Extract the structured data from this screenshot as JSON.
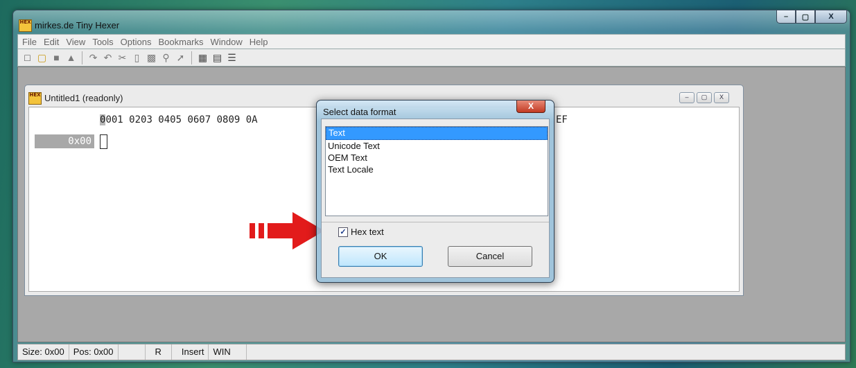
{
  "window": {
    "title": "mirkes.de Tiny Hexer",
    "app_icon_text": "HEX",
    "caption": {
      "minimize": "–",
      "maximize": "▢",
      "close": "X"
    }
  },
  "menu": {
    "items": [
      "File",
      "Edit",
      "View",
      "Tools",
      "Options",
      "Bookmarks",
      "Window",
      "Help"
    ]
  },
  "child_window": {
    "title": "Untitled1 (readonly)",
    "header_first": "0",
    "header_rest": "001 0203 0405 0607 0809 0A",
    "header_tail": "EF",
    "row_address": "0x00"
  },
  "dialog": {
    "title": "Select data format",
    "close_label": "X",
    "formats": [
      "Text",
      "Unicode Text",
      "OEM Text",
      "Text Locale"
    ],
    "selected_index": 0,
    "hex_text_label": "Hex text",
    "hex_text_checked": true,
    "ok_label": "OK",
    "cancel_label": "Cancel"
  },
  "status": {
    "size": "Size: 0x00",
    "pos": "Pos: 0x00",
    "blank": "",
    "mode": "R",
    "insert": "Insert",
    "charset": "WIN"
  },
  "colors": {
    "selection": "#3399ff",
    "arrow": "#e21b1b"
  }
}
